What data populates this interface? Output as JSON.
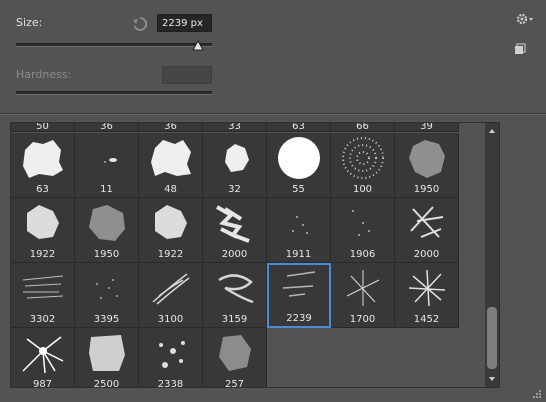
{
  "size": {
    "label": "Size:",
    "value": "2239 px",
    "slider_fraction": 0.96
  },
  "hardness": {
    "label": "Hardness:",
    "value": ""
  },
  "icons": {
    "reset": "reset-icon",
    "settings": "gear-icon",
    "new_preset": "new-preset-icon"
  },
  "brushes": {
    "partial_row": [
      "50",
      "36",
      "36",
      "33",
      "63",
      "66",
      "39"
    ],
    "rows": [
      [
        "63",
        "11",
        "48",
        "32",
        "55",
        "100",
        "1950"
      ],
      [
        "1922",
        "1950",
        "1922",
        "2000",
        "1911",
        "1906",
        "2000"
      ],
      [
        "3302",
        "3395",
        "3100",
        "3159",
        "2239",
        "1700",
        "1452"
      ],
      [
        "987",
        "2500",
        "2338",
        "257"
      ]
    ],
    "selected": "2239"
  }
}
